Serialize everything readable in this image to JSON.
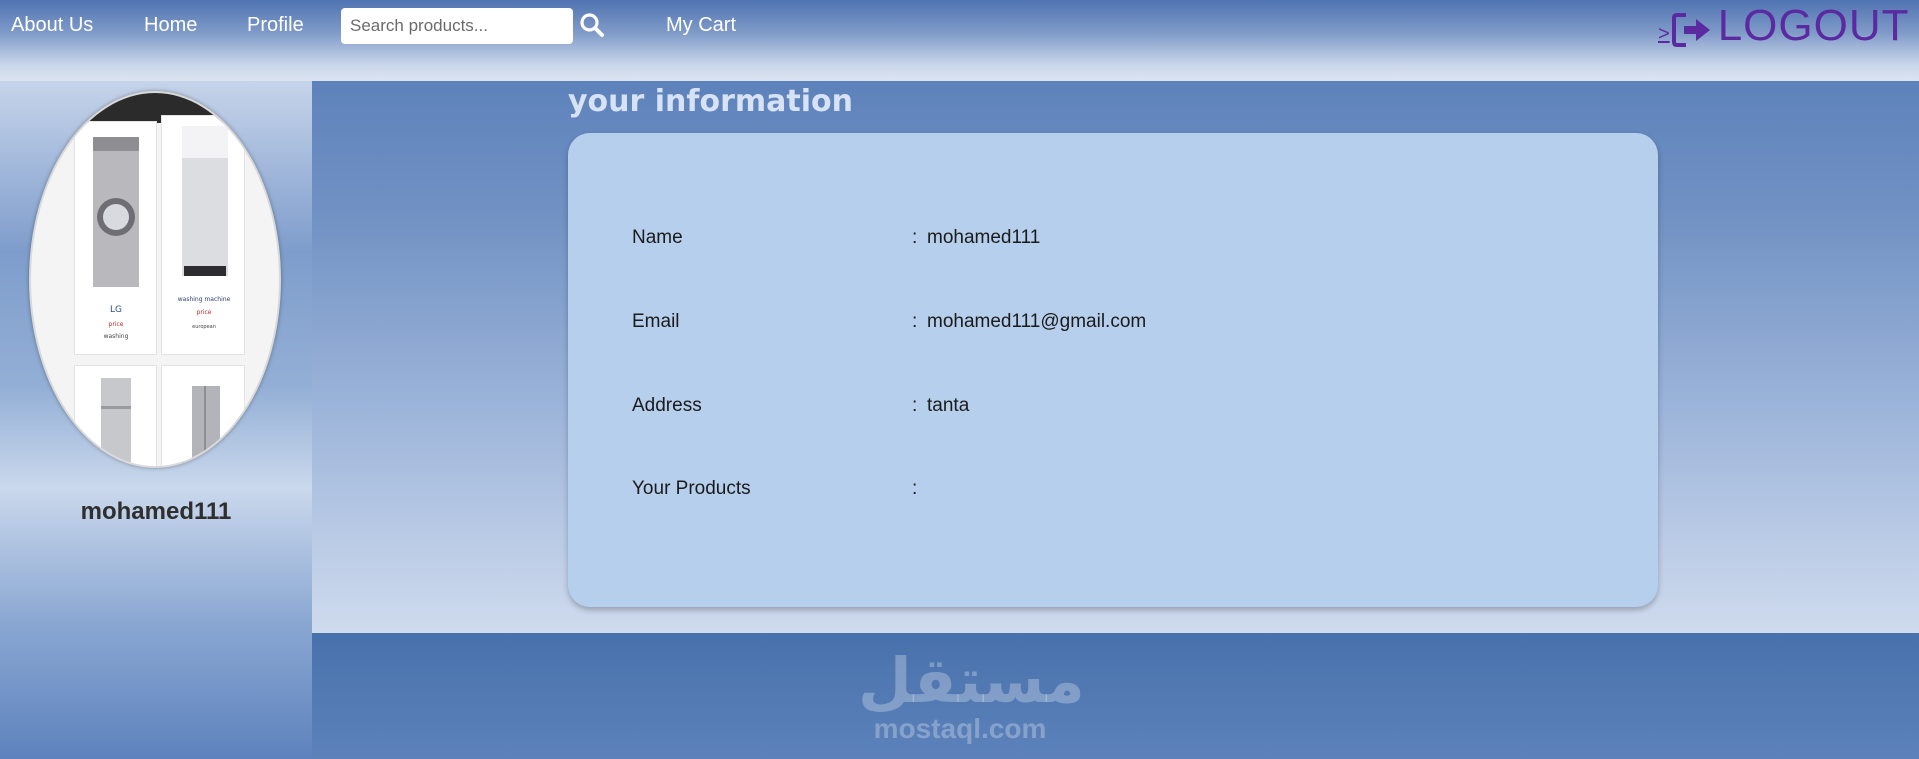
{
  "nav": {
    "about_label": "About Us",
    "home_label": "Home",
    "profile_label": "Profile",
    "search_placeholder": "Search products...",
    "search_icon": "magnifier-icon",
    "cart_label": "My Cart",
    "logout_chevron": ">",
    "logout_icon": "sign-out-icon",
    "logout_label": "LOGOUT"
  },
  "sidebar": {
    "avatar_alt": "product collage",
    "username": "mohamed111"
  },
  "main": {
    "title": "your information",
    "rows": [
      {
        "key": "Name",
        "sep": ":",
        "value": "mohamed111"
      },
      {
        "key": "Email",
        "sep": ":",
        "value": "mohamed111@gmail.com"
      },
      {
        "key": "Address",
        "sep": ":",
        "value": "tanta"
      },
      {
        "key": "Your Products",
        "sep": ":",
        "value": ""
      }
    ]
  },
  "footer": {
    "watermark_ar": "مستقل",
    "watermark_en": "mostaql.com"
  },
  "colors": {
    "logout": "#5b2aa0",
    "card": "#b6cfed",
    "title": "#d7e3f5"
  }
}
